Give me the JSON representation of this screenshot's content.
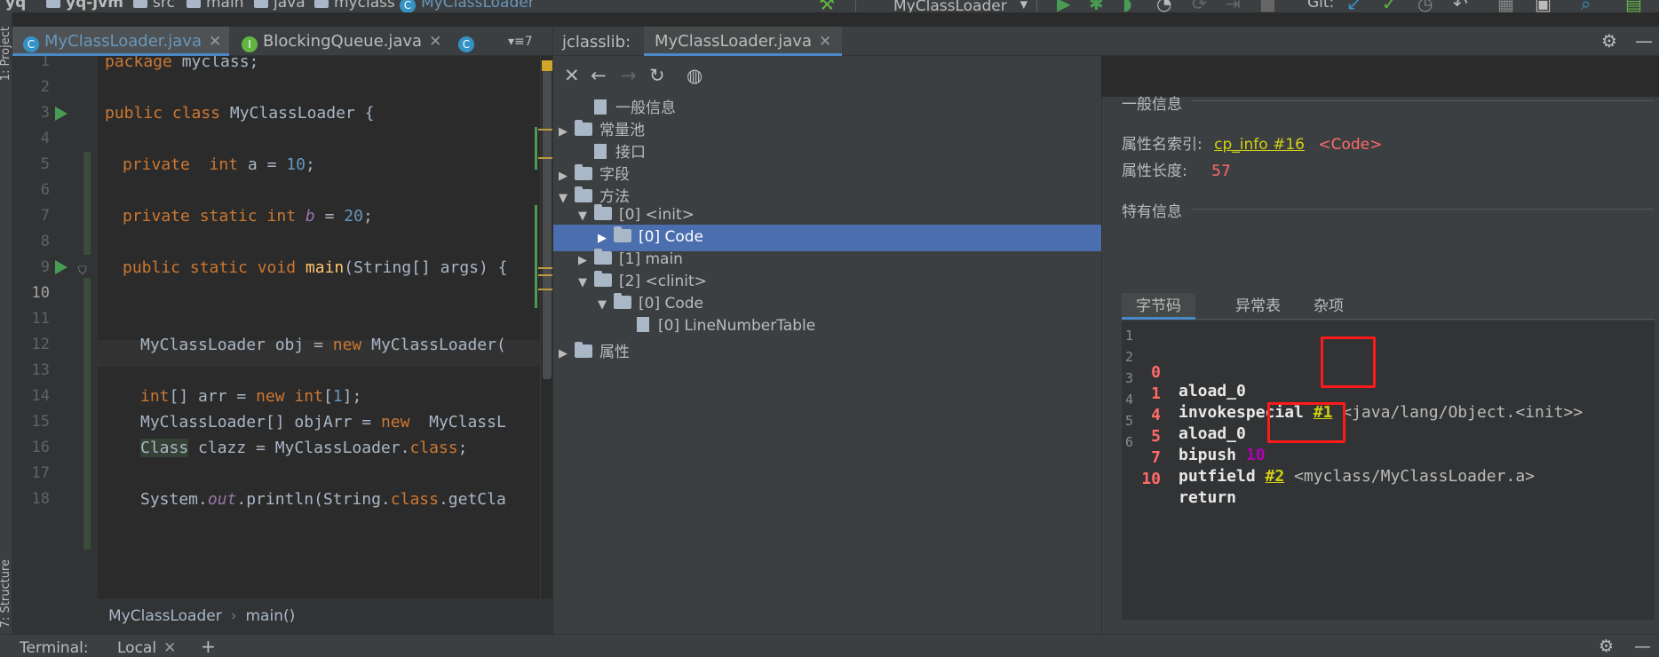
{
  "navbar": {
    "project": "yq",
    "module": "yq-jvm",
    "path": [
      "src",
      "main",
      "java",
      "myclass"
    ],
    "current_class": "MyClassLoader",
    "run_config": "MyClassLoader",
    "git_label": "Git:"
  },
  "side_panels": {
    "project": "1: Project",
    "structure": "7: Structure"
  },
  "editor": {
    "tabs": [
      {
        "label": "MyClassLoader.java",
        "icon": "class-icon",
        "active": true
      },
      {
        "label": "BlockingQueue.java",
        "icon": "interface-icon",
        "active": false
      },
      {
        "label": "",
        "icon": "class-icon",
        "active": false
      }
    ],
    "overflow": "≡7",
    "line_numbers": [
      "1",
      "2",
      "3",
      "4",
      "5",
      "6",
      "7",
      "8",
      "9",
      "10",
      "11",
      "12",
      "13",
      "14",
      "15",
      "16",
      "17",
      "18"
    ],
    "lines": {
      "l1_kw": "package",
      "l1_rest": " myclass;",
      "l3_kw": "public class",
      "l3_rest": " MyClassLoader {",
      "l5_kw1": "private",
      "l5_kw2": "int",
      "l5_rest1": " a = ",
      "l5_num": "10",
      "l5_end": ";",
      "l7_kw": "private static int",
      "l7_var": "b",
      "l7_rest": " = ",
      "l7_num": "20",
      "l7_end": ";",
      "l9_kw": "public static void",
      "l9_fn": "main",
      "l9_rest": "(String[] args) {",
      "l12_a": "MyClassLoader obj = ",
      "l12_kw": "new",
      "l12_b": " MyClassLoader(",
      "l14_kw1": "int",
      "l14_a": "[] arr = ",
      "l14_kw2": "new",
      "l14_kw3": "int",
      "l14_b": "[",
      "l14_num": "1",
      "l14_c": "];",
      "l15_a": "MyClassLoader[] objArr = ",
      "l15_kw": "new",
      "l15_b": "  MyClassL",
      "l16_a": "Class",
      "l16_b": " clazz = MyClassLoader.",
      "l16_kw": "class",
      "l16_c": ";",
      "l18_a": "System.",
      "l18_out": "out",
      "l18_b": ".println(String.",
      "l18_kw": "class",
      "l18_c": ".getCla"
    },
    "breadcrumb": [
      "MyClassLoader",
      "main()"
    ]
  },
  "jclasslib": {
    "title": "jclasslib:",
    "tab": "MyClassLoader.java",
    "tree": {
      "general": "一般信息",
      "constant_pool": "常量池",
      "interfaces": "接口",
      "fields": "字段",
      "methods": "方法",
      "init": "[0] <init>",
      "init_code": "[0] Code",
      "main": "[1] main",
      "clinit": "[2] <clinit>",
      "clinit_code": "[0] Code",
      "line_number_table": "[0] LineNumberTable",
      "attributes": "属性"
    },
    "detail": {
      "general_title": "一般信息",
      "attr_name_index_label": "属性名索引:",
      "attr_name_index_link": "cp_info #16",
      "attr_name_index_value": "<Code>",
      "attr_length_label": "属性长度:",
      "attr_length_value": "57",
      "specific_title": "特有信息",
      "subtabs": [
        "字节码",
        "异常表",
        "杂项"
      ],
      "bytecode": [
        {
          "line": "1",
          "offset": "0",
          "op": "aload_0"
        },
        {
          "line": "2",
          "offset": "1",
          "op": "invokespecial",
          "ref": "#1",
          "comment": " <java/lang/Object.<init>>"
        },
        {
          "line": "3",
          "offset": "4",
          "op": "aload_0"
        },
        {
          "line": "4",
          "offset": "5",
          "op": "bipush",
          "arg": "10"
        },
        {
          "line": "5",
          "offset": "7",
          "op": "putfield",
          "ref": "#2",
          "comment": " <myclass/MyClassLoader.a>"
        },
        {
          "line": "6",
          "offset": "10",
          "op": "return"
        }
      ]
    }
  },
  "bottom_bar": {
    "terminal_label": "Terminal:",
    "session": "Local"
  },
  "colors": {
    "accent": "#4a88c7",
    "selection": "#4b6eaf",
    "highlight_box": "#ff1a1a"
  }
}
